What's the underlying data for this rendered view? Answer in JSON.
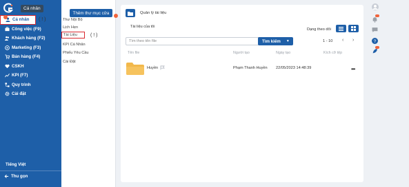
{
  "sidebar": {
    "tooltip": "Cá nhân",
    "items": [
      {
        "label": "Cá nhân",
        "icon": "user-icon"
      },
      {
        "label": "Công việc (F9)",
        "icon": "briefcase-icon"
      },
      {
        "label": "Khách hàng (F2)",
        "icon": "users-icon"
      },
      {
        "label": "Marketing (F3)",
        "icon": "target-icon"
      },
      {
        "label": "Bán hàng (F4)",
        "icon": "cart-icon"
      },
      {
        "label": "CSKH",
        "icon": "heart-icon"
      },
      {
        "label": "KPI (F7)",
        "icon": "chart-icon"
      },
      {
        "label": "Quy trình",
        "icon": "flow-icon"
      },
      {
        "label": "Cài đặt",
        "icon": "gear-icon"
      }
    ],
    "cursor_mark": "( ! )",
    "language": "Tiếng Việt",
    "collapse_label": "Thu gọn"
  },
  "submenu": {
    "add_folder_label": "Thêm thư mục cửa",
    "items": [
      "Thư Nội Bộ",
      "Lịch Hẹn",
      "Tài Liệu",
      "KPI Cá Nhân",
      "Phiếu Yêu Cầu",
      "Cài Đặt"
    ],
    "active_index": 2,
    "cursor_mark": "( ! )"
  },
  "main": {
    "title": "Quản lý tài liệu",
    "subtitle": "Tài liệu của tôi",
    "view_label": "Dạng theo dõi",
    "search_placeholder": "Tìm theo tên file",
    "search_button": "Tìm kiếm",
    "pager": "1 - 10",
    "columns": [
      "Tên file",
      "Người tạo",
      "Ngày tạo",
      "Kích cỡ tệp"
    ],
    "rows": [
      {
        "name": "Huyền",
        "creator": "Phạm Thanh Huyền",
        "created": "22/05/2023 14:48:39",
        "size": ""
      }
    ]
  },
  "colors": {
    "primary": "#1e5fa8",
    "accent_red": "#d9272e",
    "badge": "#f0643c",
    "folder": "#f2b84b"
  }
}
